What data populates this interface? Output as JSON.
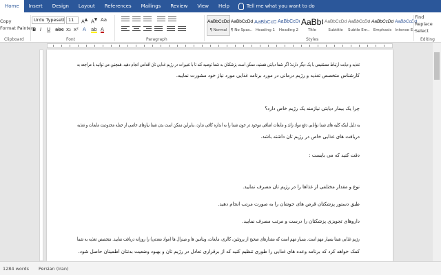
{
  "tabs": [
    "Home",
    "Insert",
    "Design",
    "Layout",
    "References",
    "Mailings",
    "Review",
    "View",
    "Help"
  ],
  "active_tab": "Home",
  "tell_me": "Tell me what you want to do",
  "clipboard": {
    "copy": "Copy",
    "format_painter": "Format Painter",
    "label": "Clipboard"
  },
  "font": {
    "family": "Urdu Typesettin",
    "size": "11",
    "label": "Font"
  },
  "paragraph": {
    "label": "Paragraph"
  },
  "styles": {
    "label": "Styles",
    "items": [
      {
        "preview": "AaBbCcDdEe",
        "name": "¶ Normal"
      },
      {
        "preview": "AaBbCcDdEe",
        "name": "¶ No Spac..."
      },
      {
        "preview": "AaBbCcDd",
        "name": "Heading 1"
      },
      {
        "preview": "AaBbCcDd",
        "name": "Heading 2"
      },
      {
        "preview": "AaBbCcDdEe",
        "name": "Title"
      },
      {
        "preview": "AaBbCcDdEe",
        "name": "Subtitle"
      },
      {
        "preview": "AaBbCcDdEe",
        "name": "Subtle Em..."
      },
      {
        "preview": "AaBbCcDdEe",
        "name": "Emphasis"
      },
      {
        "preview": "AaBbCcDdEe",
        "name": "Intense E..."
      }
    ]
  },
  "editing": {
    "find": "Find",
    "replace": "Replace",
    "select": "Select",
    "label": "Editing"
  },
  "document": {
    "lines": [
      "تغذیه و دیابت ارتباط مستقیمی با یک دیگر دارند؛ اگر شما دیابتی هستید، ممکن است پزشکتان به شما توصیه کند تا با تغییرات در رژیم غذایی تان اقدامی انجام دهید. همچنین می توانید با مراجعه به",
      "کارشناس متخصص تغذیه و رژیم درمانی در مورد برنامه غذایی مورد نیاز خود مشورت نمایید.",
      "چرا یک بیمار دیابتی نیازمند یک رژیم خاص دارد؟",
      "به دلیل اینکه کلیه های شما توانایی دفع مواد زائد و مایعات اضافی موجود در خون شما را به اندازه کافی ندارد، بنابراین ممکن است بدن شما نیازهای خاصی از جمله محدودیت مایعات و تغذیه",
      "دریافت های غذایی خاص در رژیم تان داشته باشد.",
      "دقت کنید که می بایست :",
      "نوع و مقدار مختلفی از غذاها را در رژیم تان مصرف نمایید.",
      "طبق دستور پزشکتان قرص های جوشان را به صورت مرتب انجام دهید.",
      "داروهای تجویزی پزشکتان را درست و مرتب مصرف نمایید.",
      "رژیم غذایی شما بسیار مهم است. بسیار مهم است که مقدارهای صحیح از پروتئین، کالری، مایعات، ویتامین ها و مینرال ها (مواد معدنی) را روزانه دریافت نمایید. متخصص تغذیه به شما",
      "کمک خواهد کرد که برنامه وعده های غذایی را طوری تنظیم کنید که از برقراری تعادل در رژیم تان و بهبود وضعیت بدنتان اطمینان حاصل شود."
    ]
  },
  "status": {
    "words": "1284 words",
    "language": "Persian (Iran)"
  }
}
